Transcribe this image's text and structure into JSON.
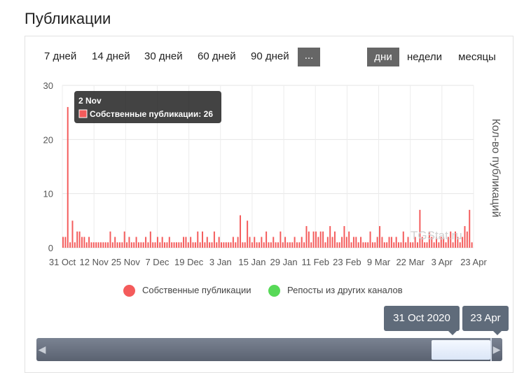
{
  "page": {
    "title": "Публикации"
  },
  "ranges": [
    "7 дней",
    "14 дней",
    "30 дней",
    "60 дней",
    "90 дней"
  ],
  "range_more_label": "...",
  "granularity": [
    "дни",
    "недели",
    "месяцы"
  ],
  "tooltip": {
    "date": "2 Nov",
    "series": "Собственные публикации",
    "value": "26"
  },
  "watermark": "TGStat.ru",
  "colors": {
    "series_own": "#f45b5b",
    "series_reposts": "#57d957",
    "accent": "#666666"
  },
  "chart_data": {
    "type": "bar",
    "xlabel": "",
    "ylabel": "Кол-во публикаций",
    "ylim": [
      0,
      30
    ],
    "yticks": [
      "0",
      "10",
      "20",
      "30"
    ],
    "x_tick_labels": [
      "31 Oct",
      "12 Nov",
      "25 Nov",
      "7 Dec",
      "19 Dec",
      "3 Jan",
      "15 Jan",
      "29 Jan",
      "11 Feb",
      "23 Feb",
      "9 Mar",
      "22 Mar",
      "3 Apr",
      "23 Apr"
    ],
    "x_range": [
      "2020-10-31",
      "2021-04-23"
    ],
    "legend": [
      "Собственные публикации",
      "Репосты из других каналов"
    ],
    "series": [
      {
        "name": "Собственные публикации",
        "values": [
          2,
          2,
          26,
          1,
          5,
          1,
          3,
          3,
          2,
          2,
          1,
          2,
          1,
          1,
          1,
          1,
          1,
          1,
          1,
          1,
          3,
          1,
          2,
          1,
          1,
          1,
          3,
          1,
          2,
          1,
          1,
          2,
          1,
          1,
          1,
          2,
          1,
          3,
          1,
          1,
          2,
          1,
          2,
          1,
          1,
          2,
          1,
          1,
          1,
          1,
          1,
          2,
          2,
          1,
          2,
          1,
          1,
          3,
          1,
          3,
          1,
          2,
          1,
          1,
          3,
          1,
          2,
          1,
          1,
          1,
          1,
          1,
          2,
          1,
          2,
          6,
          1,
          1,
          5,
          2,
          1,
          2,
          1,
          1,
          2,
          1,
          3,
          1,
          1,
          2,
          1,
          1,
          3,
          1,
          2,
          1,
          1,
          1,
          2,
          1,
          1,
          2,
          1,
          4,
          3,
          1,
          3,
          3,
          2,
          3,
          3,
          1,
          2,
          4,
          2,
          3,
          1,
          1,
          2,
          4,
          2,
          3,
          1,
          2,
          2,
          1,
          2,
          1,
          1,
          1,
          3,
          1,
          1,
          2,
          4,
          2,
          1,
          1,
          2,
          2,
          1,
          2,
          1,
          1,
          3,
          1,
          2,
          1,
          1,
          2,
          1,
          7,
          2,
          1,
          1,
          3,
          2,
          1,
          2,
          1,
          2,
          2,
          1,
          2,
          3,
          1,
          3,
          2,
          1,
          2,
          4,
          3,
          7,
          1
        ]
      },
      {
        "name": "Репосты из других каналов",
        "values": []
      }
    ]
  },
  "navigator": {
    "start_label": "31 Oct 2020",
    "end_label": "23 Apr",
    "left_arrow": "◀",
    "right_arrow": "▶"
  }
}
